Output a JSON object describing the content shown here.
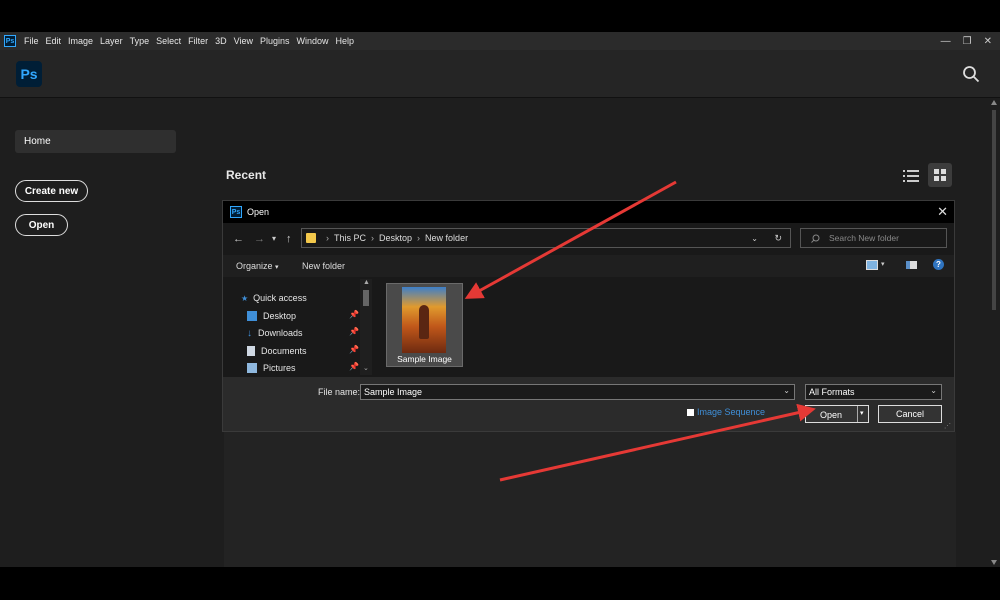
{
  "app": {
    "logo": "Ps",
    "menu": [
      "File",
      "Edit",
      "Image",
      "Layer",
      "Type",
      "Select",
      "Filter",
      "3D",
      "View",
      "Plugins",
      "Window",
      "Help"
    ],
    "window_controls": {
      "minimize": "—",
      "restore": "❐",
      "close": "✕"
    }
  },
  "sidebar": {
    "home": "Home",
    "create_new": "Create new",
    "open": "Open"
  },
  "main": {
    "recent_label": "Recent"
  },
  "dialog": {
    "logo": "Ps",
    "title": "Open",
    "breadcrumbs": [
      "This PC",
      "Desktop",
      "New folder"
    ],
    "search_placeholder": "Search New folder",
    "toolbar": {
      "organize": "Organize",
      "new_folder": "New folder"
    },
    "nav_items": [
      "Quick access",
      "Desktop",
      "Downloads",
      "Documents",
      "Pictures"
    ],
    "file": {
      "name": "Sample Image"
    },
    "file_name_label": "File name:",
    "file_name_value": "Sample Image",
    "format_value": "All Formats",
    "image_sequence_label": "Image Sequence",
    "open_button": "Open",
    "cancel_button": "Cancel"
  },
  "colors": {
    "annotation_arrow": "#e53935",
    "ps_blue": "#31a8ff",
    "ps_dark": "#001e36"
  }
}
